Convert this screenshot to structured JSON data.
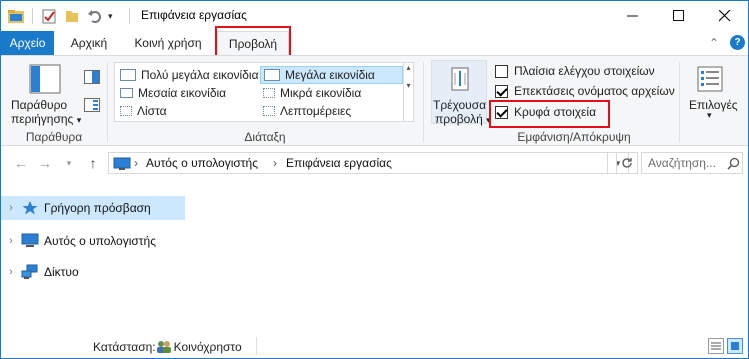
{
  "window": {
    "title": "Επιφάνεια εργασίας"
  },
  "tabs": [
    {
      "label": "Αρχείο"
    },
    {
      "label": "Αρχική"
    },
    {
      "label": "Κοινή χρήση"
    },
    {
      "label": "Προβολή"
    }
  ],
  "ribbon": {
    "panes": {
      "preview_label_line1": "Παράθυρο",
      "preview_label_line2": "περιήγησης",
      "group_label": "Παράθυρα"
    },
    "layout": {
      "items": [
        {
          "label": "Πολύ μεγάλα εικονίδια"
        },
        {
          "label": "Μεγάλα εικονίδια"
        },
        {
          "label": "Μεσαία εικονίδια"
        },
        {
          "label": "Μικρά εικονίδια"
        },
        {
          "label": "Λίστα"
        },
        {
          "label": "Λεπτομέρειες"
        }
      ],
      "group_label": "Διάταξη"
    },
    "current_view": {
      "line1": "Τρέχουσα",
      "line2": "προβολή"
    },
    "show_hide": {
      "checkboxes": [
        {
          "label": "Πλαίσια ελέγχου στοιχείων",
          "checked": false
        },
        {
          "label": "Επεκτάσεις ονόματος αρχείων",
          "checked": true
        },
        {
          "label": "Κρυφά στοιχεία",
          "checked": true
        }
      ],
      "group_label": "Εμφάνιση/Απόκρυψη"
    },
    "options": {
      "label": "Επιλογές"
    }
  },
  "address": {
    "crumbs": [
      "Αυτός ο υπολογιστής",
      "Επιφάνεια εργασίας"
    ],
    "search_placeholder": "Αναζήτηση..."
  },
  "nav_pane": {
    "items": [
      {
        "label": "Γρήγορη πρόσβαση",
        "icon": "star-icon"
      },
      {
        "label": "Αυτός ο υπολογιστής",
        "icon": "computer-icon"
      },
      {
        "label": "Δίκτυο",
        "icon": "network-icon"
      }
    ]
  },
  "status": {
    "label": "Κατάσταση:",
    "value": "Κοινόχρηστο"
  },
  "colors": {
    "accent": "#1979ca",
    "highlight": "#e3101c",
    "selection": "#cce8ff"
  }
}
